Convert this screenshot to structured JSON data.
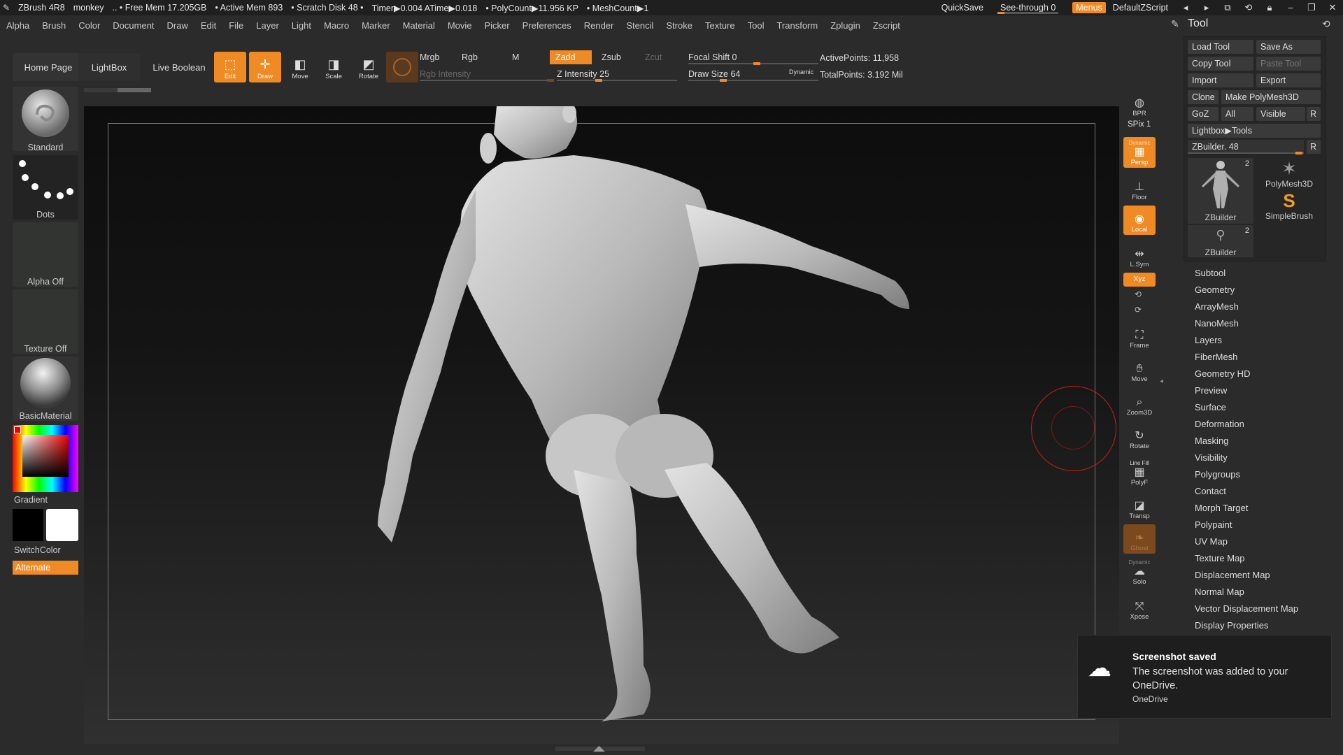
{
  "titlebar": {
    "app": "ZBrush 4R8",
    "doc": "monkey",
    "free_mem": "Free Mem 17.205GB",
    "active_mem": "Active Mem 893",
    "scratch": "Scratch Disk 48",
    "timer": "Timer▶0.004 ATime▶0.018",
    "polycount": "PolyCount▶11.956 KP",
    "meshcount": "MeshCount▶1",
    "quicksave": "QuickSave",
    "seethrough": "See-through",
    "seethrough_value": "0",
    "seethrough_fraction": 0.0,
    "menus": "Menus",
    "script": "DefaultZScript"
  },
  "menubar": [
    "Alpha",
    "Brush",
    "Color",
    "Document",
    "Draw",
    "Edit",
    "File",
    "Layer",
    "Light",
    "Macro",
    "Marker",
    "Material",
    "Movie",
    "Picker",
    "Preferences",
    "Render",
    "Stencil",
    "Stroke",
    "Texture",
    "Tool",
    "Transform",
    "Zplugin",
    "Zscript"
  ],
  "toolbar": {
    "home_page": "Home Page",
    "lightbox": "LightBox",
    "live_boolean": "Live Boolean",
    "edit": "Edit",
    "draw": "Draw",
    "move": "Move",
    "scale": "Scale",
    "rotate": "Rotate",
    "mrgb": "Mrgb",
    "rgb": "Rgb",
    "m": "M",
    "rgb_intensity": "Rgb Intensity",
    "zadd": "Zadd",
    "zsub": "Zsub",
    "zcut": "Zcut",
    "z_intensity_label": "Z Intensity",
    "z_intensity": "25",
    "focal_shift_label": "Focal Shift",
    "focal_shift": "0",
    "draw_size_label": "Draw Size",
    "draw_size": "64",
    "dynamic": "Dynamic",
    "active_points": "ActivePoints: 11,958",
    "total_points": "TotalPoints: 3.192 Mil"
  },
  "left_palette": {
    "brush": "Standard",
    "stroke": "Dots",
    "alpha": "Alpha Off",
    "texture": "Texture Off",
    "material": "BasicMaterial",
    "gradient": "Gradient",
    "switchcolor": "SwitchColor",
    "alternate": "Alternate"
  },
  "shelf": {
    "bpr": "BPR",
    "spix_label": "SPix",
    "spix": "1",
    "dynamic": "Dynamic",
    "persp": "Persp",
    "floor": "Floor",
    "local": "Local",
    "lsym": "L.Sym",
    "xyz": "Xyz",
    "frame": "Frame",
    "move": "Move",
    "zoom3d": "Zoom3D",
    "rotate": "Rotate",
    "line_fill": "Line Fill",
    "polyf": "PolyF",
    "transp": "Transp",
    "ghost": "Ghost",
    "dynamic2": "Dynamic",
    "solo": "Solo",
    "xpose": "Xpose"
  },
  "tool_panel": {
    "title": "Tool",
    "load_tool": "Load Tool",
    "save_as": "Save As",
    "copy_tool": "Copy Tool",
    "paste_tool": "Paste Tool",
    "import": "Import",
    "export": "Export",
    "clone": "Clone",
    "make_polymesh": "Make PolyMesh3D",
    "goz": "GoZ",
    "all": "All",
    "visible": "Visible",
    "r": "R",
    "lightbox_tools": "Lightbox▶Tools",
    "zbuilder_slider": "ZBuilder. 48",
    "thumbs": [
      {
        "name": "ZBuilder",
        "count": "2"
      },
      {
        "name": "PolyMesh3D",
        "count": ""
      },
      {
        "name": "SimpleBrush",
        "count": ""
      },
      {
        "name": "ZBuilder",
        "count": "2"
      }
    ],
    "sections": [
      "Subtool",
      "Geometry",
      "ArrayMesh",
      "NanoMesh",
      "Layers",
      "FiberMesh",
      "Geometry HD",
      "Preview",
      "Surface",
      "Deformation",
      "Masking",
      "Visibility",
      "Polygroups",
      "Contact",
      "Morph Target",
      "Polypaint",
      "UV Map",
      "Texture Map",
      "Displacement Map",
      "Normal Map",
      "Vector Displacement Map",
      "Display Properties"
    ]
  },
  "toast": {
    "title": "Screenshot saved",
    "body": "The screenshot was added to your OneDrive.",
    "source": "OneDrive"
  },
  "colors": {
    "accent": "#f08a24",
    "panel": "#2b2b2b",
    "button": "#3a3a3a"
  }
}
